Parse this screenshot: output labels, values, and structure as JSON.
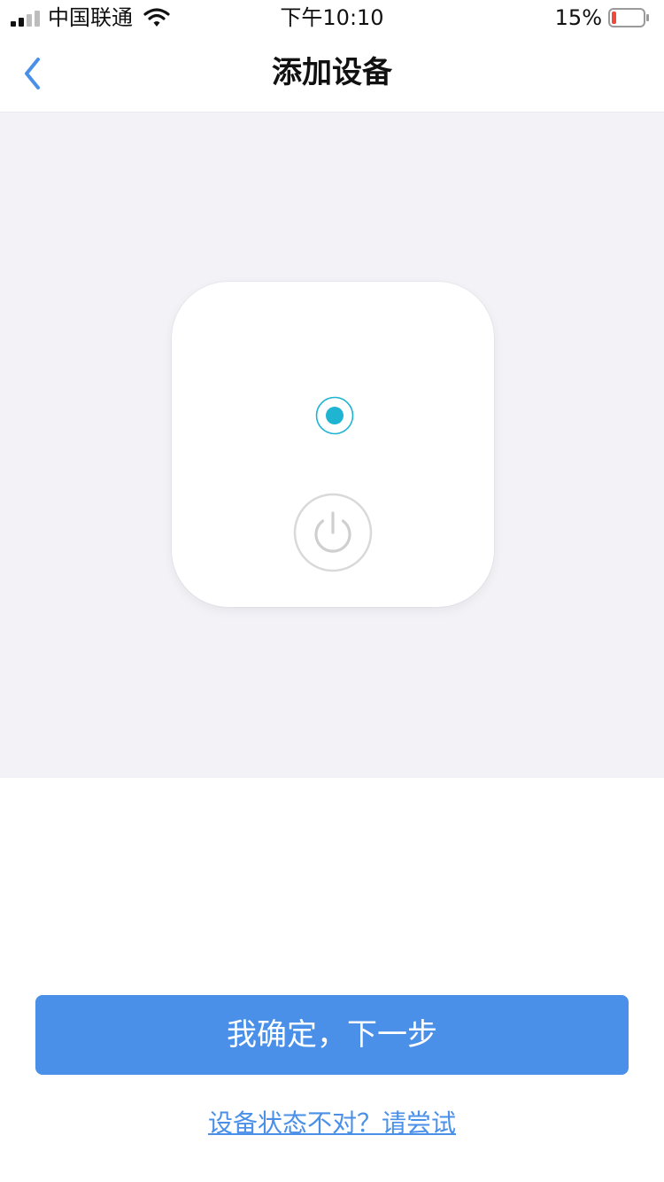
{
  "status_bar": {
    "carrier": "中国联通",
    "time": "下午10:10",
    "battery_percent": "15%",
    "battery_level": 0.15,
    "signal_icon": "signal-icon",
    "wifi_icon": "wifi-icon",
    "battery_icon": "battery-icon"
  },
  "nav": {
    "title": "添加设备",
    "back_icon": "chevron-left-icon"
  },
  "illustration": {
    "indicator_icon": "indicator-light-icon",
    "power_icon": "power-icon"
  },
  "actions": {
    "confirm_label": "我确定，下一步",
    "help_link_label": "设备状态不对？请尝试"
  },
  "colors": {
    "accent": "#4a90e8",
    "indicator": "#1eb4d2",
    "illustration_bg": "#f2f2f7",
    "battery_low": "#f04a3c"
  }
}
